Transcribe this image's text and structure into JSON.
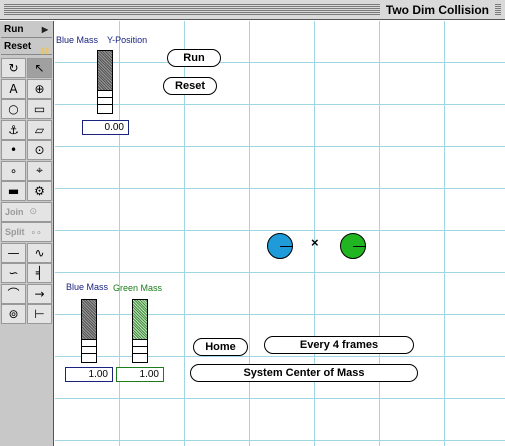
{
  "window": {
    "title": "Two Dim Collision"
  },
  "toolbox": {
    "run_label": "Run",
    "reset_label": "Reset",
    "join_label": "Join",
    "split_label": "Split",
    "tools": [
      {
        "name": "rotate-tool-icon",
        "glyph": "↻"
      },
      {
        "name": "pointer-tool-icon",
        "glyph": "↖"
      },
      {
        "name": "text-tool-icon",
        "glyph": "A"
      },
      {
        "name": "zoom-tool-icon",
        "glyph": "⊕"
      },
      {
        "name": "circle-tool-icon",
        "glyph": "○"
      },
      {
        "name": "rectangle-tool-icon",
        "glyph": "▭"
      },
      {
        "name": "anchor-tool-icon",
        "glyph": "⚓"
      },
      {
        "name": "polygon-tool-icon",
        "glyph": "▱"
      },
      {
        "name": "point-tool-icon",
        "glyph": "•"
      },
      {
        "name": "pin-joint-tool-icon",
        "glyph": "⊙"
      },
      {
        "name": "small-point-tool-icon",
        "glyph": "∘"
      },
      {
        "name": "slot-joint-tool-icon",
        "glyph": "⌖"
      },
      {
        "name": "rigid-joint-tool-icon",
        "glyph": "▬"
      },
      {
        "name": "motor-tool-icon",
        "glyph": "⚙"
      },
      {
        "name": "rod-tool-icon",
        "glyph": "—"
      },
      {
        "name": "spring-tool-icon",
        "glyph": "∿"
      },
      {
        "name": "rope-tool-icon",
        "glyph": "∽"
      },
      {
        "name": "damper-tool-icon",
        "glyph": "╡"
      },
      {
        "name": "pulley-tool-icon",
        "glyph": "⌒"
      },
      {
        "name": "force-tool-icon",
        "glyph": "→"
      },
      {
        "name": "actuator-tool-icon",
        "glyph": "⊚"
      },
      {
        "name": "separator-tool-icon",
        "glyph": "⊢"
      }
    ]
  },
  "controls": {
    "y_slider": {
      "label_blue": "Blue Mass",
      "label_y": "Y-Position",
      "value": "0.00"
    },
    "run_label": "Run",
    "reset_label": "Reset",
    "mass_sliders": {
      "blue_label": "Blue Mass",
      "green_label": "Green Mass",
      "blue_value": "1.00",
      "green_value": "1.00"
    },
    "home_label": "Home",
    "frames_label": "Every 4 frames",
    "system_com_label": "System Center of Mass"
  },
  "scene": {
    "center_marker": "×",
    "blue_color": "#1e9bd8",
    "green_color": "#22b522"
  }
}
